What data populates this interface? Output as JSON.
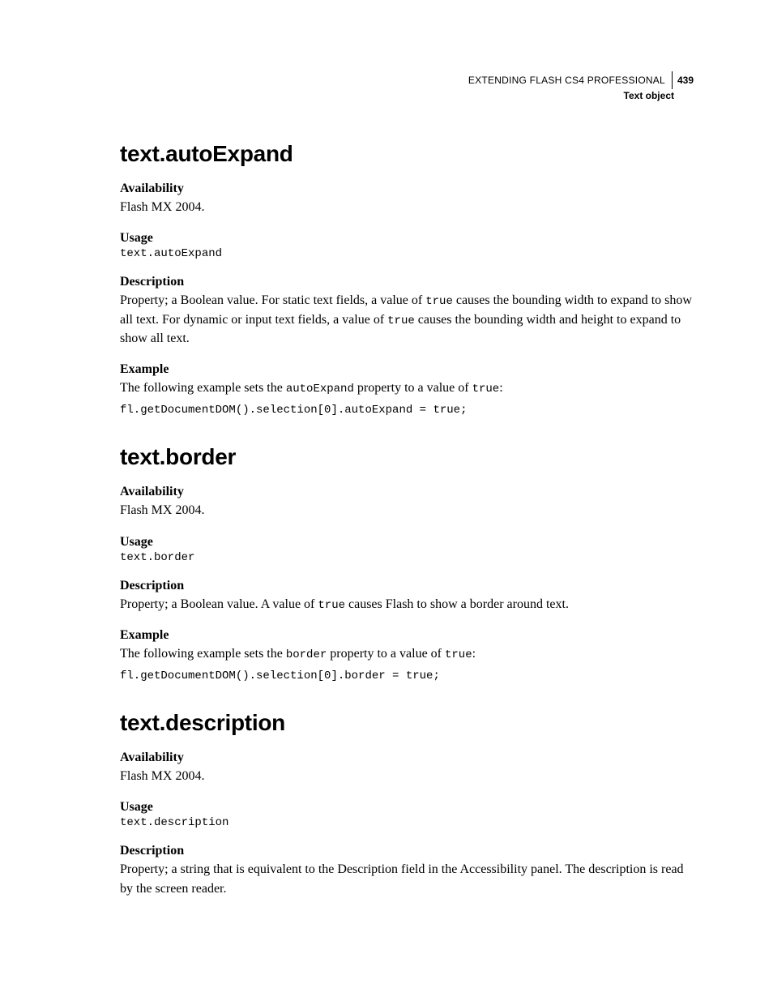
{
  "header": {
    "doc_title": "EXTENDING FLASH CS4 PROFESSIONAL",
    "page_number": "439",
    "subtitle": "Text object"
  },
  "sections": [
    {
      "title": "text.autoExpand",
      "availability_label": "Availability",
      "availability_text": "Flash MX 2004.",
      "usage_label": "Usage",
      "usage_code": "text.autoExpand",
      "description_label": "Description",
      "description_pre": "Property; a Boolean value. For static text fields, a value of ",
      "description_code1": "true",
      "description_mid": " causes the bounding width to expand to show all text. For dynamic or input text fields, a value of ",
      "description_code2": "true",
      "description_post": " causes the bounding width and height to expand to show all text.",
      "example_label": "Example",
      "example_pre": "The following example sets the ",
      "example_code1": "autoExpand",
      "example_mid": " property to a value of ",
      "example_code2": "true",
      "example_post": ":",
      "example_block": "fl.getDocumentDOM().selection[0].autoExpand = true;"
    },
    {
      "title": "text.border",
      "availability_label": "Availability",
      "availability_text": "Flash MX 2004.",
      "usage_label": "Usage",
      "usage_code": "text.border",
      "description_label": "Description",
      "description_pre": "Property; a Boolean value. A value of ",
      "description_code1": "true",
      "description_mid": "",
      "description_code2": "",
      "description_post": " causes Flash to show a border around text.",
      "example_label": "Example",
      "example_pre": "The following example sets the ",
      "example_code1": "border",
      "example_mid": " property to a value of ",
      "example_code2": "true",
      "example_post": ":",
      "example_block": "fl.getDocumentDOM().selection[0].border = true;"
    },
    {
      "title": "text.description",
      "availability_label": "Availability",
      "availability_text": "Flash MX 2004.",
      "usage_label": "Usage",
      "usage_code": "text.description",
      "description_label": "Description",
      "description_pre": "Property; a string that is equivalent to the Description field in the Accessibility panel. The description is read by the screen reader.",
      "description_code1": "",
      "description_mid": "",
      "description_code2": "",
      "description_post": ""
    }
  ]
}
